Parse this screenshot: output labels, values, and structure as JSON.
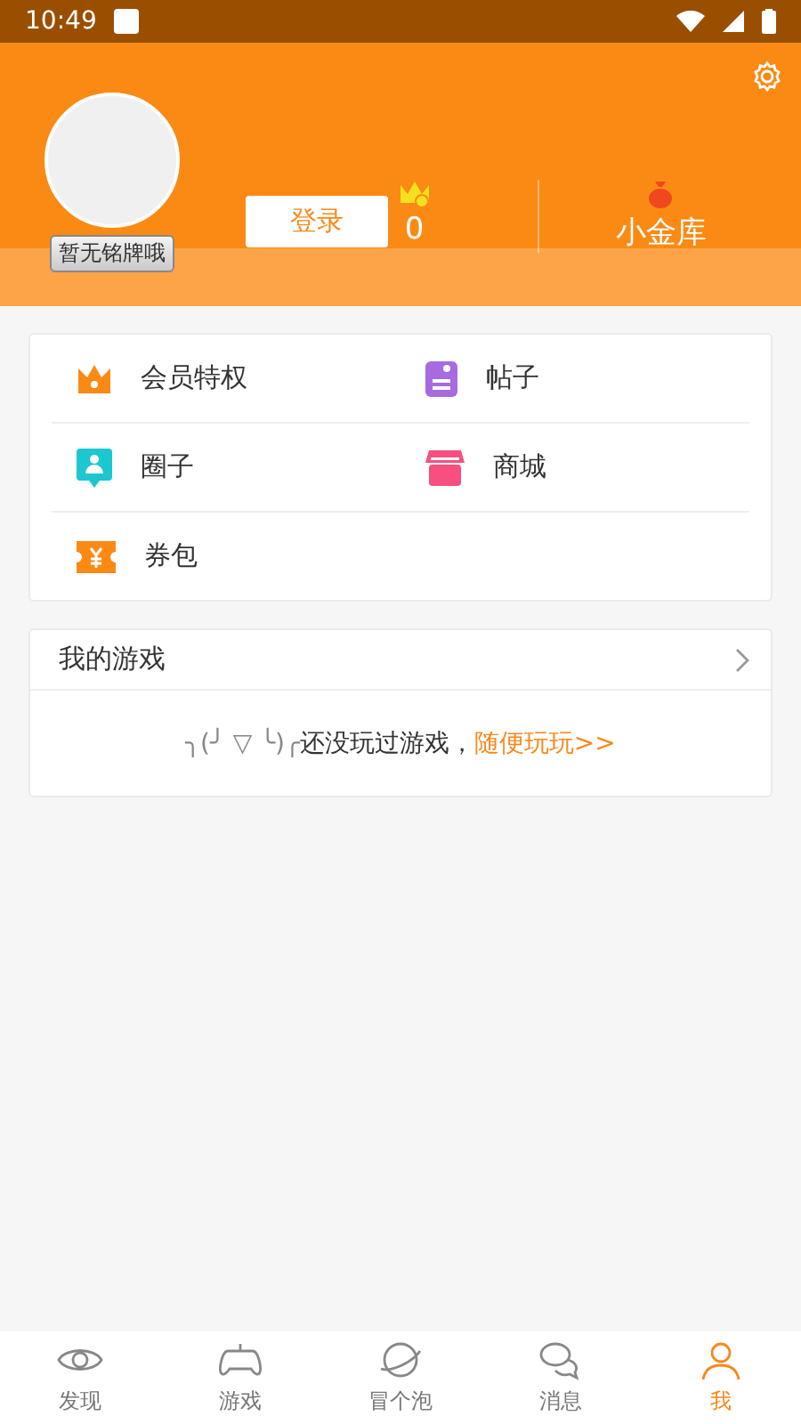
{
  "status_bar": {
    "time": "10:49"
  },
  "profile": {
    "badge": "暂无铭牌哦",
    "login_button": "登录",
    "stats": [
      {
        "kind": "crown",
        "value": "0"
      },
      {
        "kind": "bag",
        "value": "小金库"
      }
    ]
  },
  "menu": [
    {
      "kind": "crown",
      "label": "会员特权"
    },
    {
      "kind": "post",
      "label": "帖子"
    },
    {
      "kind": "circle",
      "label": "圈子"
    },
    {
      "kind": "store",
      "label": "商城"
    },
    {
      "kind": "coupon",
      "label": "券包"
    }
  ],
  "my_games": {
    "title": "我的游戏",
    "emoticon": "╮(╯ ▽ ╰)╭",
    "empty_text": "还没玩过游戏，",
    "link": "随便玩玩>>"
  },
  "tabs": [
    {
      "kind": "eye",
      "label": "发现",
      "selected": false
    },
    {
      "kind": "gamepad",
      "label": "游戏",
      "selected": false
    },
    {
      "kind": "planet",
      "label": "冒个泡",
      "selected": false
    },
    {
      "kind": "chat",
      "label": "消息",
      "selected": false
    },
    {
      "kind": "person",
      "label": "我",
      "selected": true
    }
  ]
}
